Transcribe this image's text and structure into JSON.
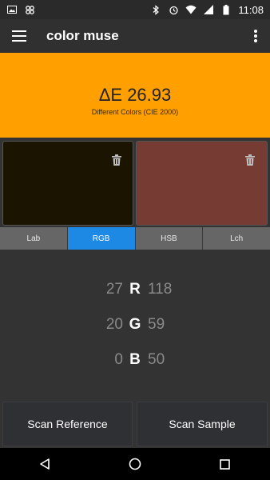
{
  "status_bar": {
    "time": "11:08",
    "left_icons": [
      "image-icon",
      "notification-icon"
    ],
    "right_icons": [
      "bluetooth-icon",
      "alarm-icon",
      "wifi-icon",
      "signal-icon",
      "battery-icon"
    ]
  },
  "app_bar": {
    "title": "color muse",
    "menu_icon": "hamburger-menu-icon",
    "overflow_icon": "more-vert-icon"
  },
  "comparison": {
    "delta_label": "ΔE 26.93",
    "description": "Different Colors (CIE 2000)",
    "background_color": "#ffa000"
  },
  "swatches": {
    "reference": {
      "color": "#1b1400",
      "action_icon": "trash-icon"
    },
    "sample": {
      "color": "#763b32",
      "action_icon": "trash-icon"
    }
  },
  "tabs": [
    {
      "label": "Lab",
      "active": false
    },
    {
      "label": "RGB",
      "active": true
    },
    {
      "label": "HSB",
      "active": false
    },
    {
      "label": "Lch",
      "active": false
    }
  ],
  "channels": [
    {
      "name": "R",
      "reference": "27",
      "sample": "118"
    },
    {
      "name": "G",
      "reference": "20",
      "sample": "59"
    },
    {
      "name": "B",
      "reference": "0",
      "sample": "50"
    }
  ],
  "buttons": {
    "scan_reference": "Scan Reference",
    "scan_sample": "Scan Sample"
  },
  "nav_bar": {
    "back_icon": "back-icon",
    "home_icon": "home-icon",
    "recents_icon": "recents-icon"
  },
  "colors": {
    "accent": "#1e88e5",
    "delta_bg": "#ffa000",
    "background": "#333333"
  }
}
